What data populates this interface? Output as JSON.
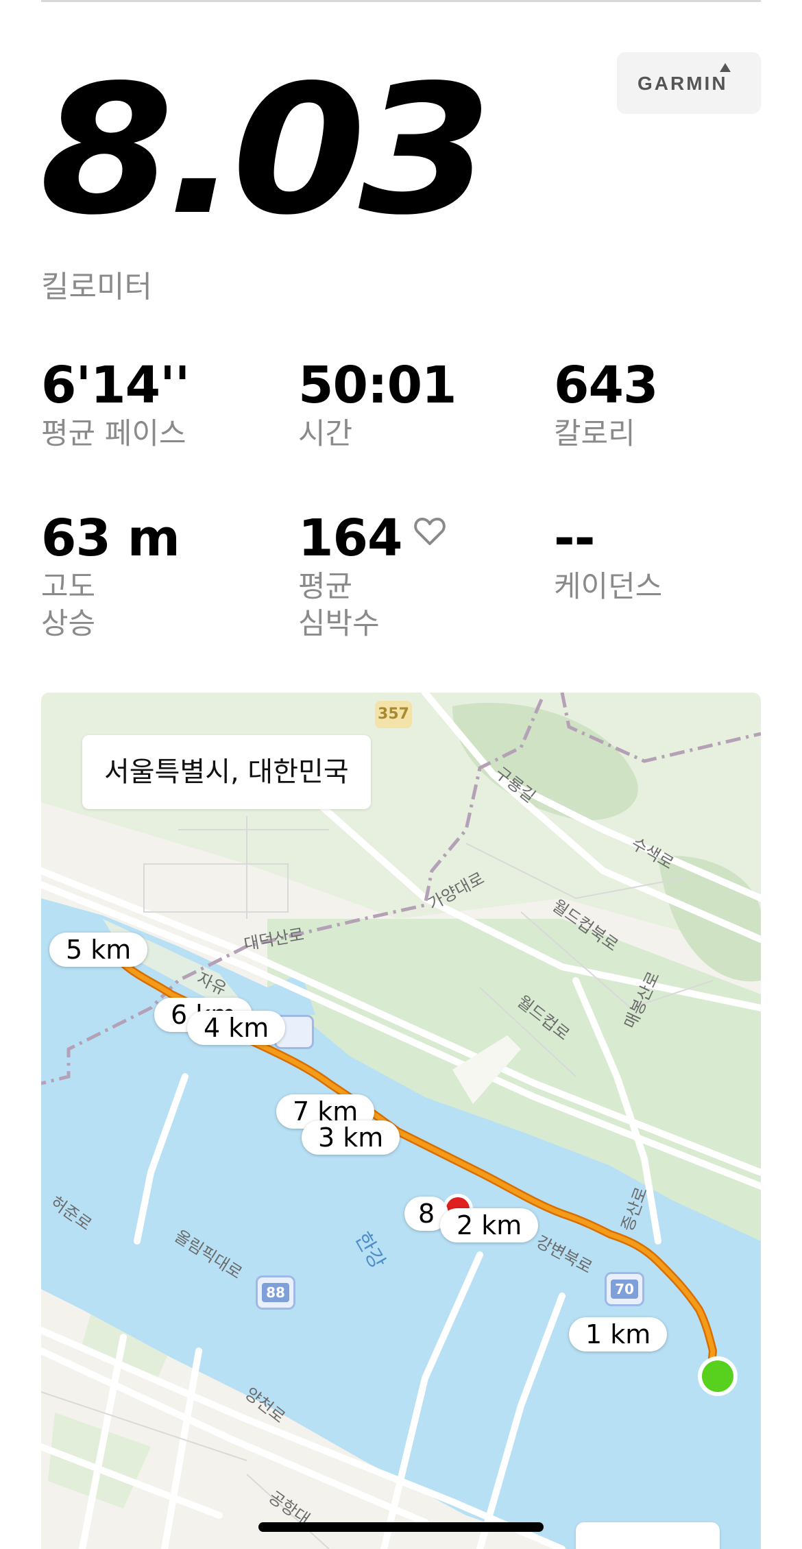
{
  "summary": {
    "distance_value": "8.03",
    "distance_unit": "킬로미터",
    "brand": "GARMIN"
  },
  "stats": [
    {
      "value": "6'14''",
      "label": "평균 페이스"
    },
    {
      "value": "50:01",
      "label": "시간"
    },
    {
      "value": "643",
      "label": "칼로리"
    },
    {
      "value": "63 m",
      "label": "고도\n상승"
    },
    {
      "value": "164",
      "label": "평균\n심박수",
      "icon": "heart-outline-icon"
    },
    {
      "value": "--",
      "label": "케이던스"
    }
  ],
  "map": {
    "location": "서울특별시, 대한민국",
    "km_markers": [
      "5 km",
      "6 km",
      "4 km",
      "7 km",
      "3 km",
      "8",
      "2 km",
      "1 km"
    ],
    "place_labels": [
      "구룡길",
      "수색로",
      "가양대로",
      "월드컵북로",
      "매봉산로",
      "대덕산로",
      "자유",
      "월드컵로",
      "증산로",
      "강변북로",
      "허준로",
      "올림픽대로",
      "한강",
      "양천로",
      "공항대"
    ],
    "road_shields": [
      "357",
      "88",
      "70"
    ],
    "colors": {
      "route": "#f59b1a",
      "water": "#b8e0f5",
      "start_marker": "#58d01e",
      "end_marker": "#e01f1f"
    }
  }
}
